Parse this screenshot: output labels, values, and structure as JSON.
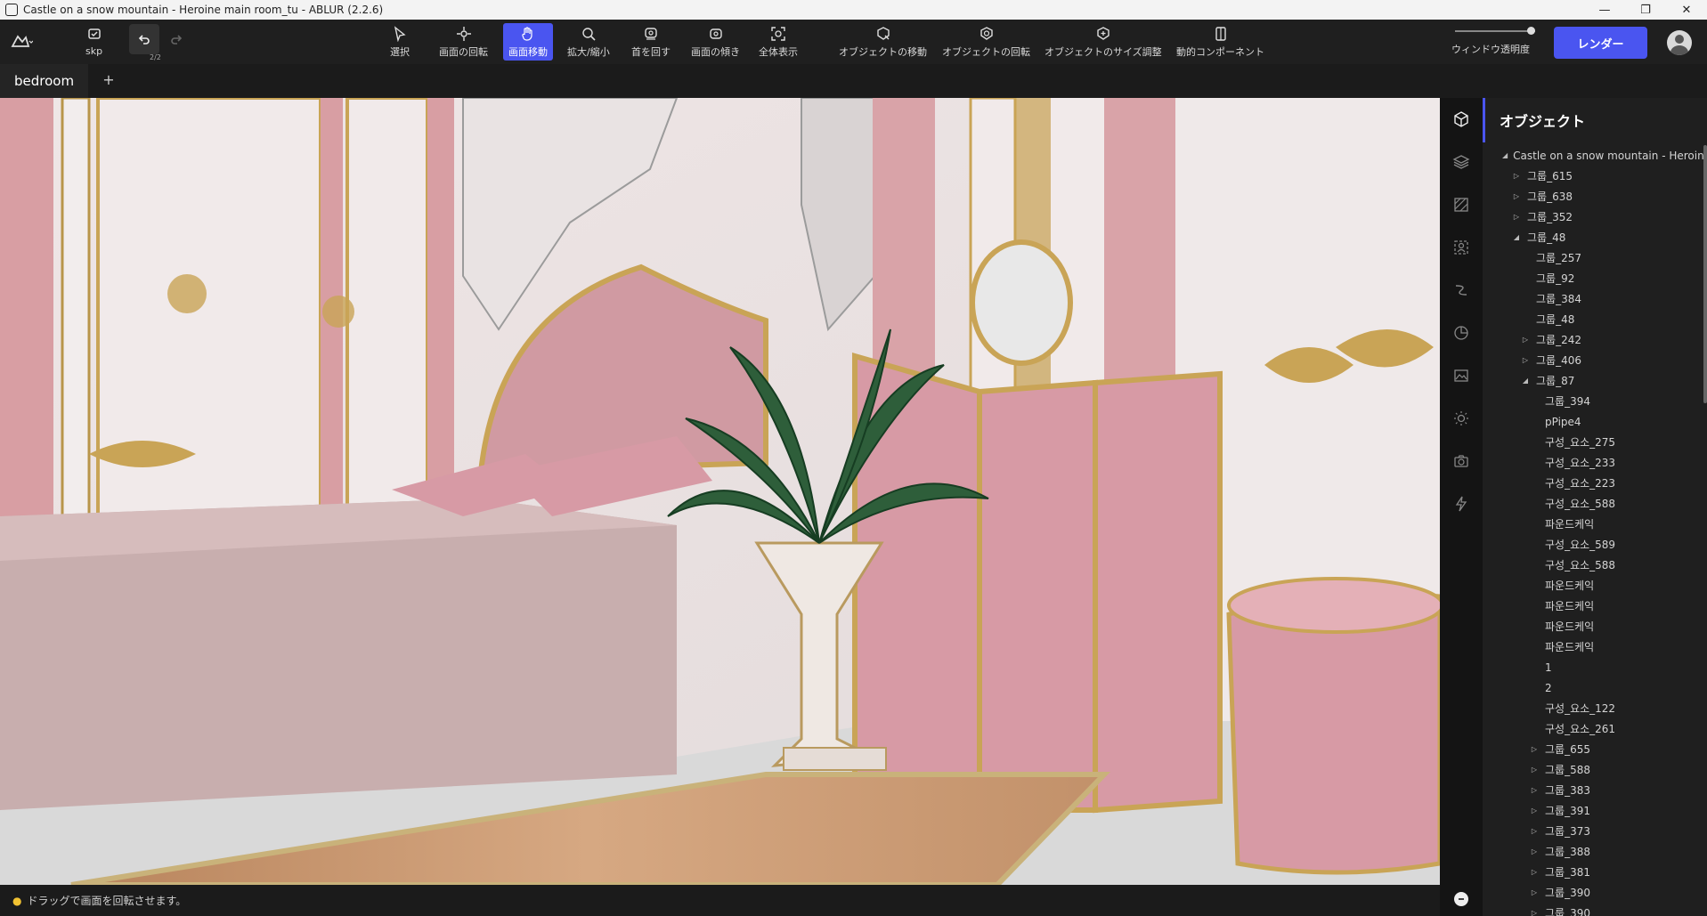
{
  "window": {
    "title": "Castle on a snow mountain - Heroine main room_tu - ABLUR (2.2.6)",
    "controls": [
      "—",
      "❐",
      "✕"
    ]
  },
  "toolbar": {
    "skp_label": "skp",
    "undo_count": "2/2",
    "tools": [
      {
        "label": "選択",
        "icon": "cursor-icon"
      },
      {
        "label": "画面の回転",
        "icon": "rotate-view-icon"
      },
      {
        "label": "画面移動",
        "icon": "hand-icon",
        "active": true
      },
      {
        "label": "拡大/縮小",
        "icon": "zoom-icon"
      },
      {
        "label": "首を回す",
        "icon": "look-around-icon"
      },
      {
        "label": "画面の傾き",
        "icon": "tilt-icon"
      },
      {
        "label": "全体表示",
        "icon": "fit-all-icon"
      },
      {
        "label": "オブジェクトの移動",
        "icon": "move-object-icon"
      },
      {
        "label": "オブジェクトの回転",
        "icon": "rotate-object-icon"
      },
      {
        "label": "オブジェクトのサイズ調整",
        "icon": "scale-object-icon"
      },
      {
        "label": "動的コンポーネント",
        "icon": "dynamic-component-icon"
      }
    ],
    "opacity_label": "ウィンドウ透明度",
    "opacity_value": 0.95,
    "render_label": "レンダー"
  },
  "tabs": {
    "current": "bedroom",
    "add": "+"
  },
  "status": {
    "hint": "ドラッグで画面を回転させます。"
  },
  "colors": {
    "accent": "#4a55f0"
  },
  "panel": {
    "title": "オブジェクト",
    "tree": [
      {
        "label": "Castle on a snow mountain - Heroin",
        "depth": 0,
        "toggle": "open"
      },
      {
        "label": "그룹_615",
        "depth": 1,
        "toggle": "closed"
      },
      {
        "label": "그룹_638",
        "depth": 1,
        "toggle": "closed"
      },
      {
        "label": "그룹_352",
        "depth": 1,
        "toggle": "closed"
      },
      {
        "label": "그룹_48",
        "depth": 1,
        "toggle": "open"
      },
      {
        "label": "그룹_257",
        "depth": 2,
        "toggle": ""
      },
      {
        "label": "그룹_92",
        "depth": 2,
        "toggle": ""
      },
      {
        "label": "그룹_384",
        "depth": 2,
        "toggle": ""
      },
      {
        "label": "그룹_48",
        "depth": 2,
        "toggle": ""
      },
      {
        "label": "그룹_242",
        "depth": 2,
        "toggle": "closed"
      },
      {
        "label": "그룹_406",
        "depth": 2,
        "toggle": "closed"
      },
      {
        "label": "그룹_87",
        "depth": 2,
        "toggle": "open"
      },
      {
        "label": "그룹_394",
        "depth": 3,
        "toggle": ""
      },
      {
        "label": "pPipe4",
        "depth": 3,
        "toggle": ""
      },
      {
        "label": "구성_요소_275",
        "depth": 3,
        "toggle": ""
      },
      {
        "label": "구성_요소_233",
        "depth": 3,
        "toggle": ""
      },
      {
        "label": "구성_요소_223",
        "depth": 3,
        "toggle": ""
      },
      {
        "label": "구성_요소_588",
        "depth": 3,
        "toggle": ""
      },
      {
        "label": "파운드케익",
        "depth": 3,
        "toggle": ""
      },
      {
        "label": "구성_요소_589",
        "depth": 3,
        "toggle": ""
      },
      {
        "label": "구성_요소_588",
        "depth": 3,
        "toggle": ""
      },
      {
        "label": "파운드케익",
        "depth": 3,
        "toggle": ""
      },
      {
        "label": "파운드케익",
        "depth": 3,
        "toggle": ""
      },
      {
        "label": "파운드케익",
        "depth": 3,
        "toggle": ""
      },
      {
        "label": "파운드케익",
        "depth": 3,
        "toggle": ""
      },
      {
        "label": "1",
        "depth": 3,
        "toggle": ""
      },
      {
        "label": "2",
        "depth": 3,
        "toggle": ""
      },
      {
        "label": "구성_요소_122",
        "depth": 3,
        "toggle": ""
      },
      {
        "label": "구성_요소_261",
        "depth": 3,
        "toggle": ""
      },
      {
        "label": "그룹_655",
        "depth": 3,
        "toggle": "closed"
      },
      {
        "label": "그룹_588",
        "depth": 3,
        "toggle": "closed"
      },
      {
        "label": "그룹_383",
        "depth": 3,
        "toggle": "closed"
      },
      {
        "label": "그룹_391",
        "depth": 3,
        "toggle": "closed"
      },
      {
        "label": "그룹_373",
        "depth": 3,
        "toggle": "closed"
      },
      {
        "label": "그룹_388",
        "depth": 3,
        "toggle": "closed"
      },
      {
        "label": "그룹_381",
        "depth": 3,
        "toggle": "closed"
      },
      {
        "label": "그룹_390",
        "depth": 3,
        "toggle": "closed"
      },
      {
        "label": "그룹_390",
        "depth": 3,
        "toggle": "closed"
      }
    ]
  }
}
